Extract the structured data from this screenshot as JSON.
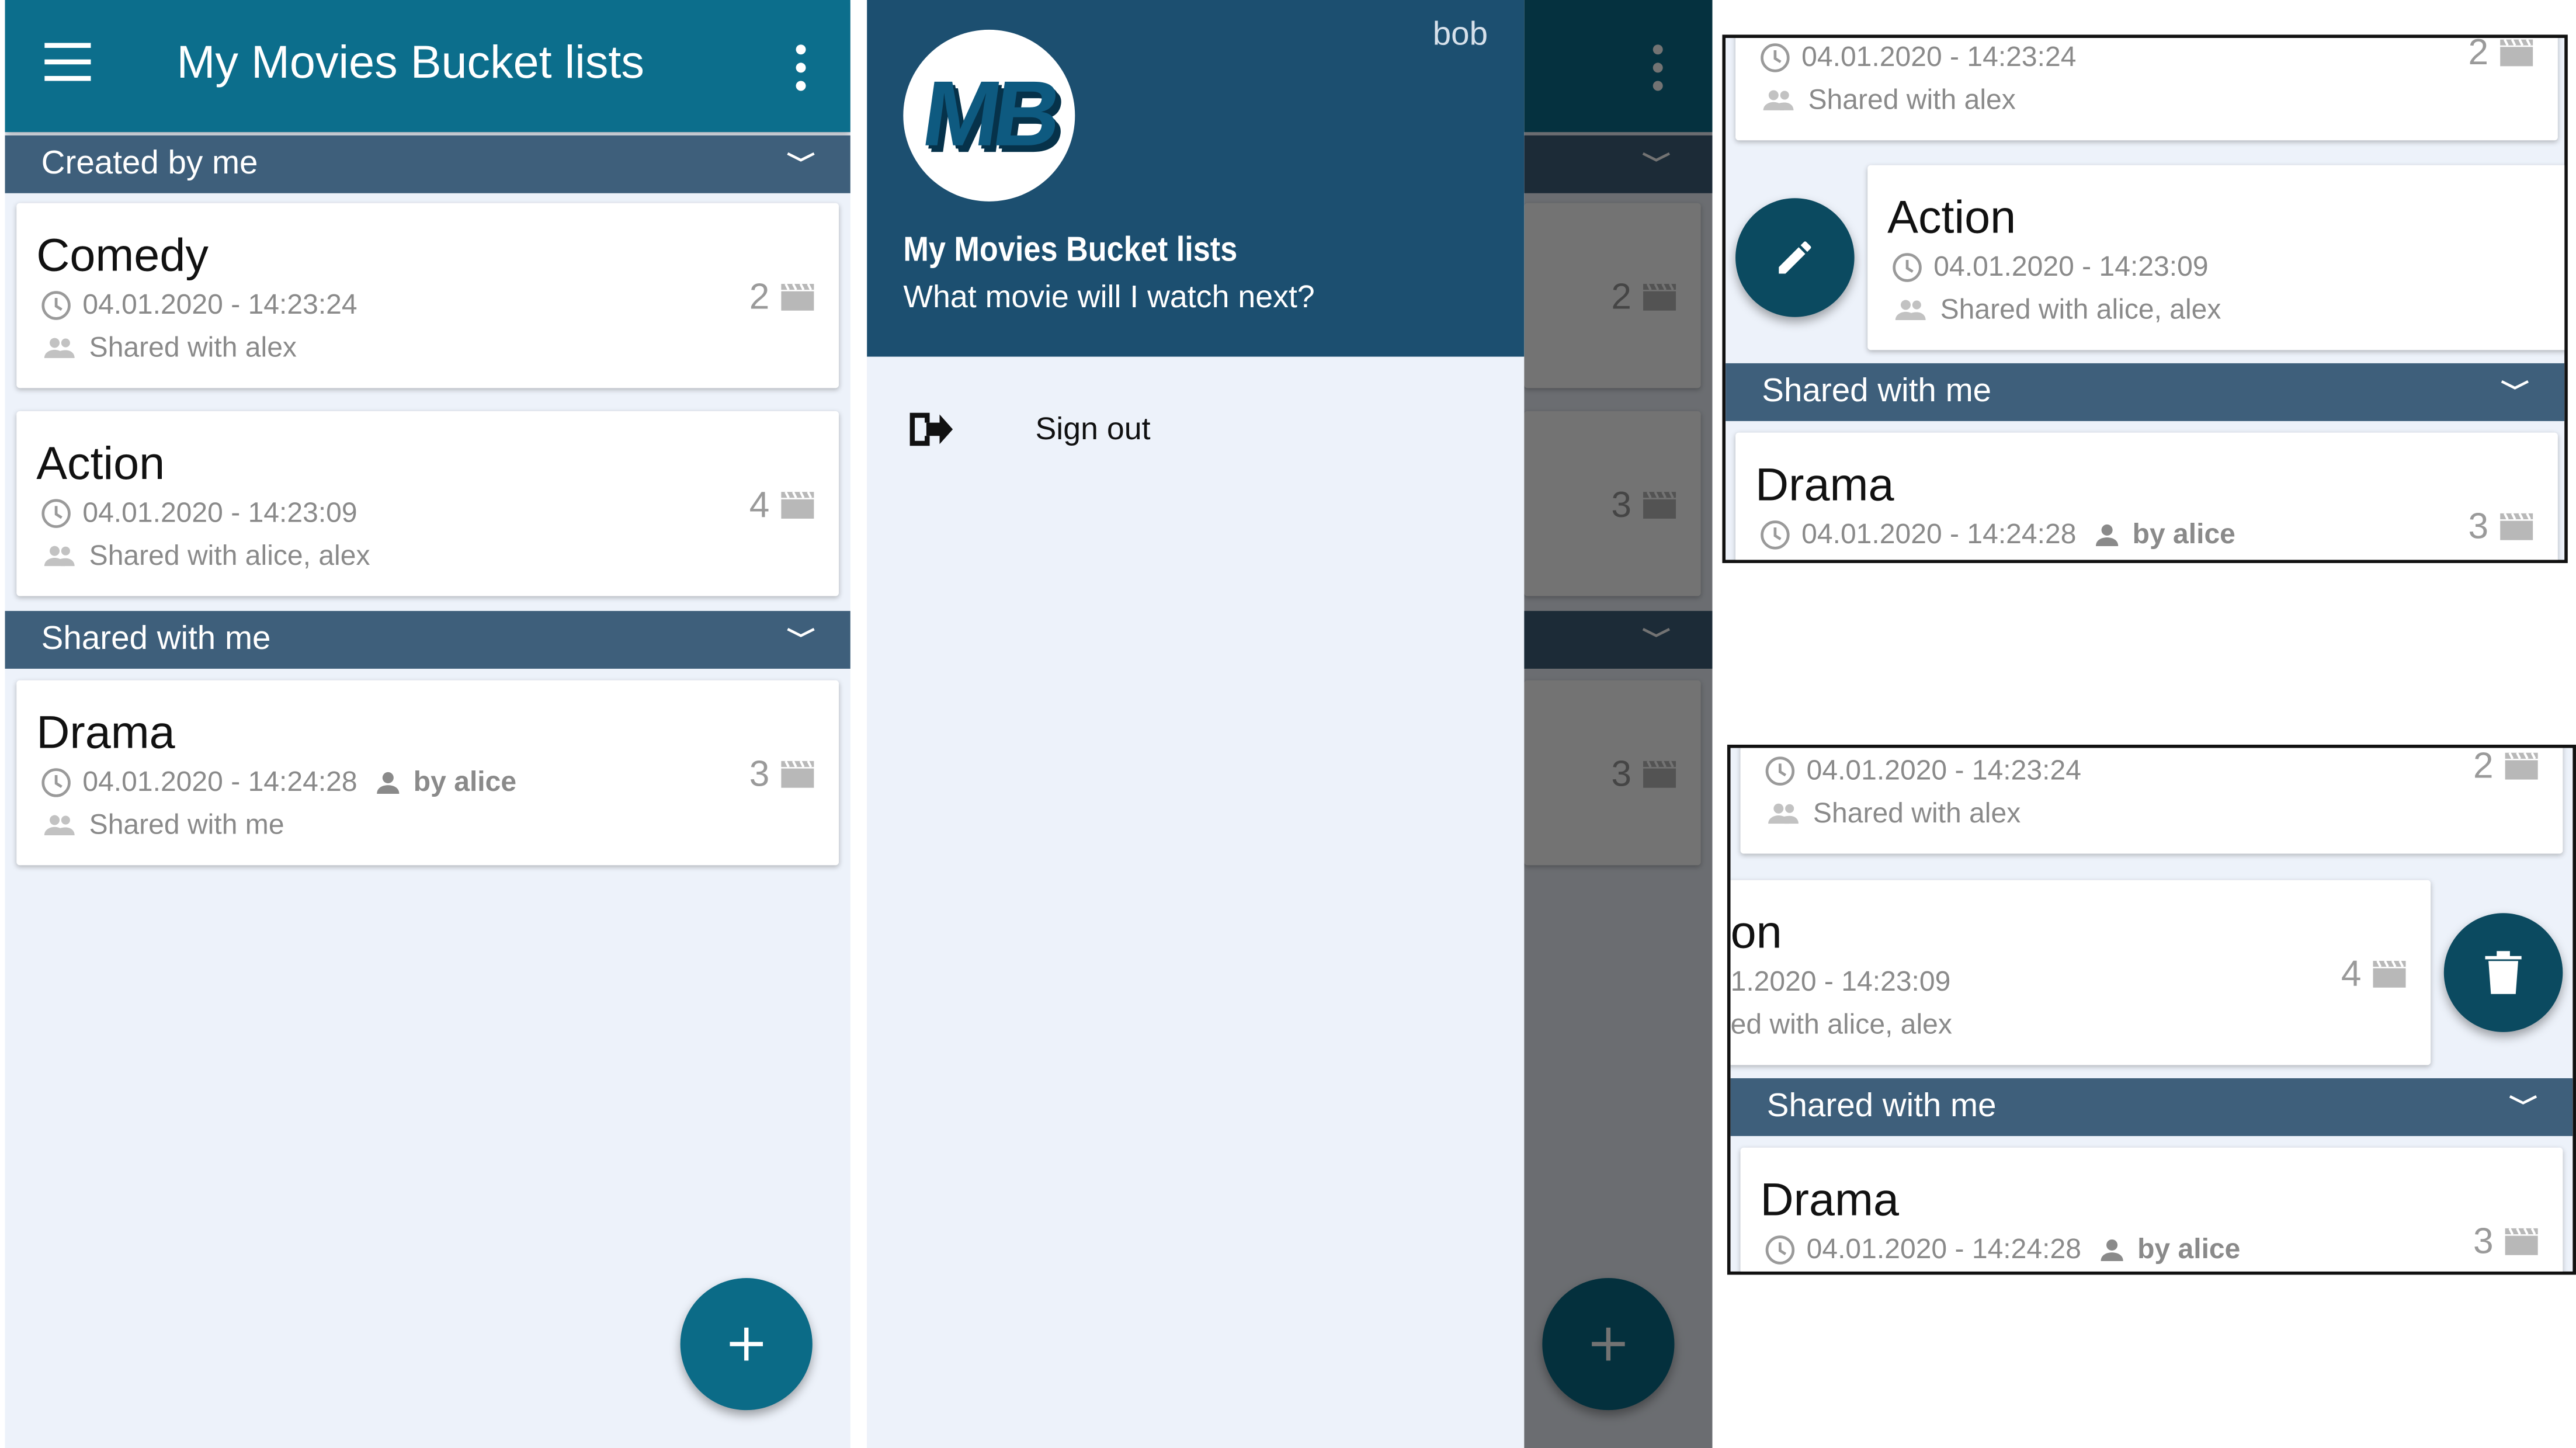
{
  "app": {
    "title": "My Movies Bucket lists",
    "accent_color": "#0c6e8c",
    "section_color": "#3e5f7b",
    "background_color": "#edf2fa"
  },
  "sections": {
    "created": "Created by me",
    "shared": "Shared with me"
  },
  "lists": {
    "comedy": {
      "title": "Comedy",
      "date": "04.01.2020 - 14:23:24",
      "shared": "Shared with alex",
      "count": "2"
    },
    "action": {
      "title": "Action",
      "date": "04.01.2020 - 14:23:09",
      "shared": "Shared with alice, alex",
      "count": "4"
    },
    "drama": {
      "title": "Drama",
      "date": "04.01.2020 - 14:24:28",
      "owner": "by alice",
      "shared": "Shared with me",
      "count": "3"
    }
  },
  "drawer": {
    "user": "bob",
    "logo_text": "MB",
    "app_name": "My Movies Bucket lists",
    "tagline": "What movie will I watch next?",
    "sign_out": "Sign out",
    "header_color": "#1c4f70"
  },
  "swipe_delete": {
    "partial_title": "on",
    "partial_date": "1.2020 - 14:23:09",
    "partial_shared": "ed with alice, alex"
  },
  "dim_counts": [
    "2",
    "3",
    "3"
  ],
  "icons": {
    "menu": "hamburger-menu-icon",
    "overflow": "more-vert-icon",
    "clock": "clock-icon",
    "people": "people-icon",
    "person": "person-icon",
    "film": "clapperboard-icon",
    "add": "plus-icon",
    "edit": "pencil-icon",
    "delete": "trash-icon",
    "signout": "logout-arrow-icon",
    "chevron": "chevron-down-icon"
  }
}
